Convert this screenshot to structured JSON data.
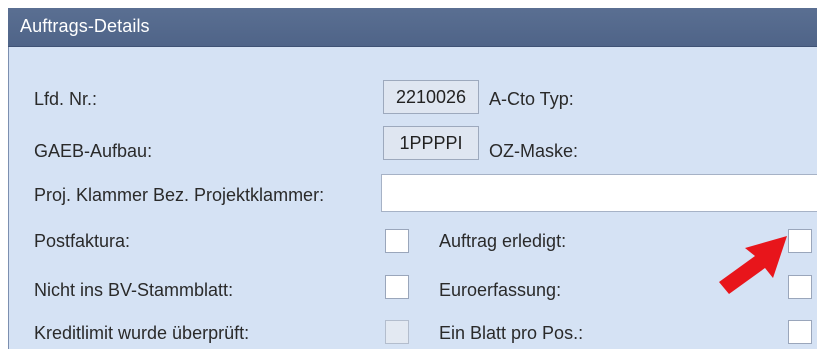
{
  "window": {
    "title": "Auftrags-Details"
  },
  "fields": {
    "lfd_nr": {
      "label": "Lfd. Nr.:",
      "value": "2210026"
    },
    "a_cto_typ": {
      "label": "A-Cto Typ:"
    },
    "gaeb_aufbau": {
      "label": "GAEB-Aufbau:",
      "value": "1PPPPI"
    },
    "oz_maske": {
      "label": "OZ-Maske:"
    },
    "proj_klammer": {
      "label": "Proj. Klammer Bez. Projektklammer:",
      "value": ""
    }
  },
  "checkboxes": {
    "postfaktura": {
      "label": "Postfaktura:",
      "checked": false
    },
    "nicht_ins_bv": {
      "label": "Nicht ins BV-Stammblatt:",
      "checked": false
    },
    "kreditlimit": {
      "label": "Kreditlimit wurde überprüft:",
      "checked": false,
      "enabled": false
    },
    "auftrag_erledigt": {
      "label": "Auftrag erledigt:",
      "checked": false
    },
    "euroerfassung": {
      "label": "Euroerfassung:",
      "checked": false
    },
    "ein_blatt": {
      "label": "Ein Blatt pro Pos.:",
      "checked": false
    }
  },
  "annotation": {
    "arrow_color": "#e8151b",
    "icon": "red-arrow-icon"
  }
}
